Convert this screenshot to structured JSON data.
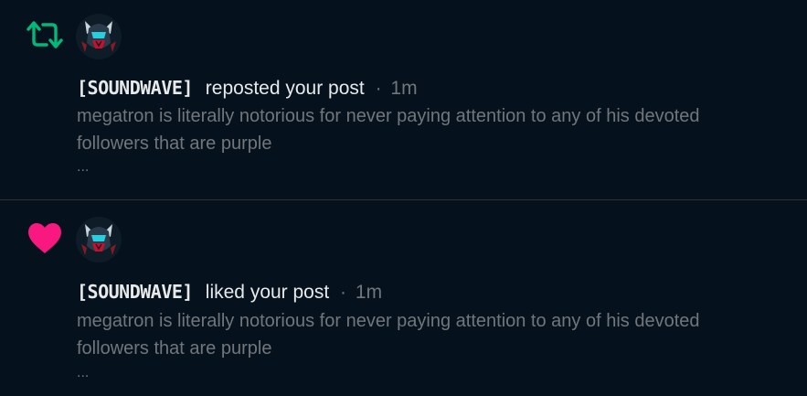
{
  "notifications": [
    {
      "type": "repost",
      "icon": "repost-icon",
      "icon_color": "#00ba7c",
      "avatar": "soundwave-avatar",
      "username": "[SOUNDWAVE]",
      "action": "reposted your post",
      "dot": "·",
      "time": "1m",
      "text": "megatron is literally notorious for never paying attention to any of his devoted followers that are purple",
      "more": "..."
    },
    {
      "type": "like",
      "icon": "heart-icon",
      "icon_color": "#f91880",
      "avatar": "soundwave-avatar",
      "username": "[SOUNDWAVE]",
      "action": "liked your post",
      "dot": "·",
      "time": "1m",
      "text": "megatron is literally notorious for never paying attention to any of his devoted followers that are purple",
      "more": "..."
    }
  ]
}
